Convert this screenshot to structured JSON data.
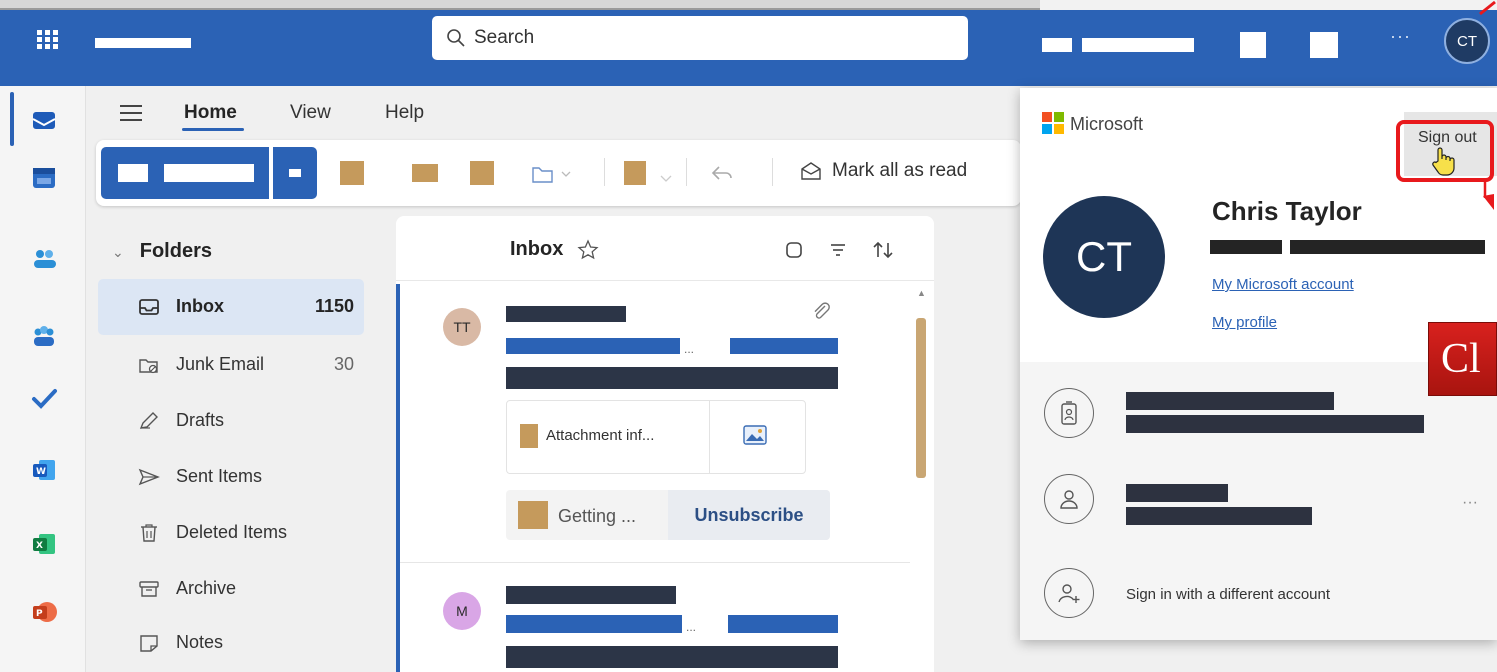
{
  "topbar": {
    "search_placeholder": "Search",
    "avatar_initials": "CT",
    "more_label": "···"
  },
  "ribbon": {
    "tabs": [
      "Home",
      "View",
      "Help"
    ],
    "mark_all_read": "Mark all as read"
  },
  "folders": {
    "header": "Folders",
    "items": [
      {
        "label": "Inbox",
        "count": "1150",
        "icon": "inbox-icon"
      },
      {
        "label": "Junk Email",
        "count": "30",
        "icon": "junk-icon"
      },
      {
        "label": "Drafts",
        "count": "",
        "icon": "drafts-icon"
      },
      {
        "label": "Sent Items",
        "count": "",
        "icon": "sent-icon"
      },
      {
        "label": "Deleted Items",
        "count": "",
        "icon": "trash-icon"
      },
      {
        "label": "Archive",
        "count": "",
        "icon": "archive-icon"
      },
      {
        "label": "Notes",
        "count": "",
        "icon": "notes-icon"
      }
    ]
  },
  "message_list": {
    "title": "Inbox",
    "messages": [
      {
        "avatar": "TT",
        "attachment_name": "Attachment inf...",
        "preview_chip": "Getting ...",
        "action": "Unsubscribe"
      },
      {
        "avatar": "M"
      }
    ]
  },
  "account_flyout": {
    "brand": "Microsoft",
    "sign_out": "Sign out",
    "initials": "CT",
    "name": "Chris Taylor",
    "my_account_link": "My Microsoft account",
    "my_profile_link": "My profile",
    "sign_in_different": "Sign in with a different account",
    "more_label": "···",
    "overlay_tag": "Cl"
  },
  "colors": {
    "brand_blue": "#2b62b5",
    "highlight_red": "#e8191c",
    "redacted_tan": "#c59a5c"
  }
}
